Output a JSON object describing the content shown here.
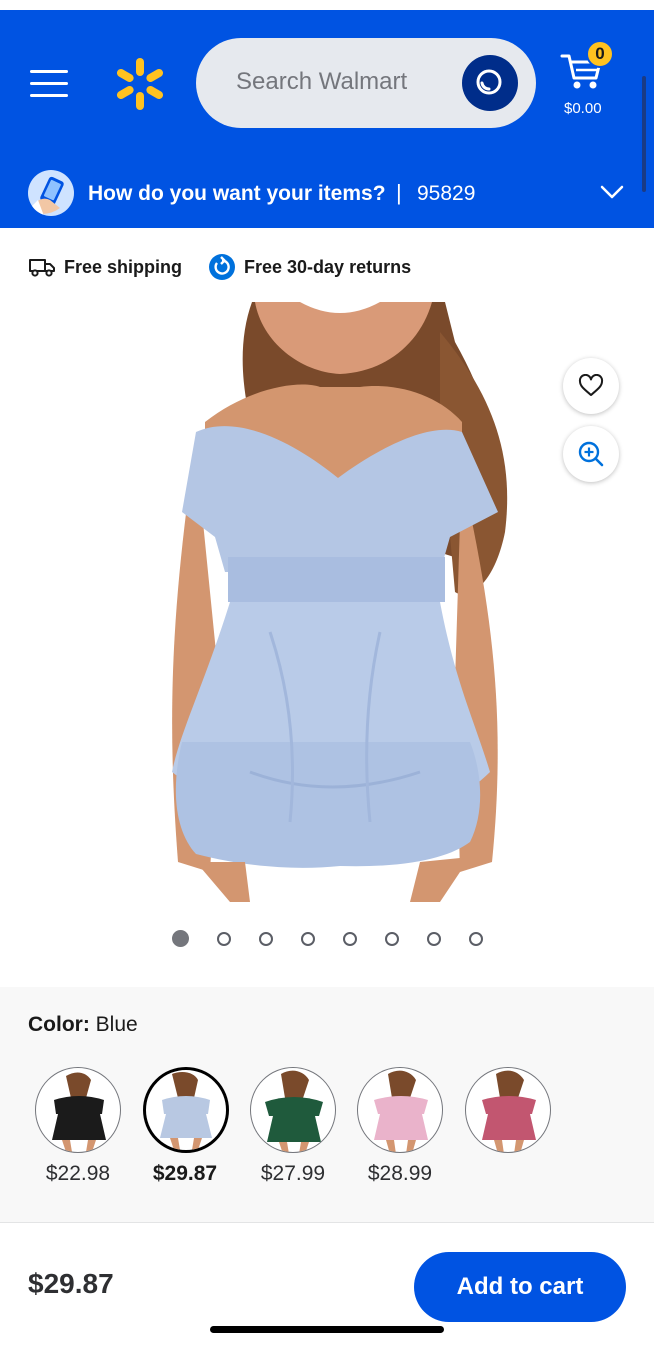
{
  "header": {
    "search_placeholder": "Search Walmart",
    "cart_count": "0",
    "cart_total": "$0.00",
    "brand_color": "#0053e2",
    "spark_color": "#ffc220"
  },
  "delivery": {
    "prompt": "How do you want your items?",
    "separator": "|",
    "zip": "95829"
  },
  "badges": {
    "shipping": "Free shipping",
    "returns": "Free 30-day returns"
  },
  "gallery": {
    "image_count": 8,
    "active_index": 0
  },
  "variants": {
    "label": "Color:",
    "selected": "Blue",
    "options": [
      {
        "price": "$22.98",
        "color": "#1b1b1b",
        "selected": false
      },
      {
        "price": "$29.87",
        "color": "#b8c8e2",
        "selected": true
      },
      {
        "price": "$27.99",
        "color": "#1f5a3c",
        "selected": false
      },
      {
        "price": "$28.99",
        "color": "#eab3cb",
        "selected": false
      },
      {
        "price": "",
        "color": "#c25670",
        "selected": false
      }
    ]
  },
  "bottom": {
    "price": "$29.87",
    "add_to_cart": "Add to cart"
  }
}
